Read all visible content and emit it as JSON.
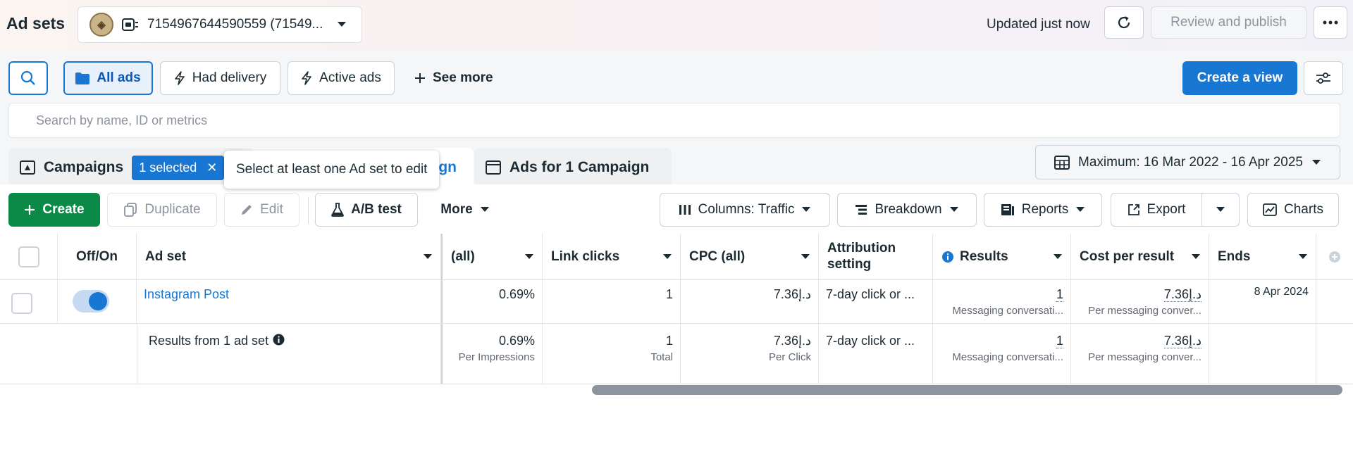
{
  "header": {
    "title": "Ad sets",
    "account_id": "7154967644590559 (71549...",
    "updated": "Updated just now",
    "review_publish": "Review and publish"
  },
  "filters": {
    "all_ads": "All ads",
    "had_delivery": "Had delivery",
    "active_ads": "Active ads",
    "see_more": "See more",
    "create_view": "Create a view"
  },
  "search": {
    "placeholder": "Search by name, ID or metrics"
  },
  "tabs": {
    "campaigns": "Campaigns",
    "selected": "1 selected",
    "adsets_visible": "ign",
    "ads": "Ads for 1 Campaign"
  },
  "tooltip": "Select at least one Ad set to edit",
  "date_range": "Maximum: 16 Mar 2022 - 16 Apr 2025",
  "toolbar": {
    "create": "Create",
    "duplicate": "Duplicate",
    "edit": "Edit",
    "ab_test": "A/B test",
    "more": "More",
    "columns": "Columns: Traffic",
    "breakdown": "Breakdown",
    "reports": "Reports",
    "export": "Export",
    "charts": "Charts"
  },
  "table": {
    "headers": {
      "off_on": "Off/On",
      "ad_set": "Ad set",
      "ctr": "(all)",
      "link_clicks": "Link clicks",
      "cpc": "CPC (all)",
      "attribution": "Attribution setting",
      "results": "Results",
      "cost_per_result": "Cost per result",
      "ends": "Ends"
    },
    "row": {
      "name": "Instagram Post",
      "ctr": "0.69%",
      "link_clicks": "1",
      "cpc": "7.36د.إ",
      "attribution": "7-day click or ...",
      "results": "1",
      "results_sub": "Messaging conversati...",
      "cost": "7.36د.إ",
      "cost_sub": "Per messaging conver...",
      "ends": "8 Apr 2024"
    },
    "summary": {
      "label": "Results from 1 ad set",
      "ctr": "0.69%",
      "ctr_sub": "Per Impressions",
      "link_clicks": "1",
      "link_clicks_sub": "Total",
      "cpc": "7.36د.إ",
      "cpc_sub": "Per Click",
      "attribution": "7-day click or ...",
      "results": "1",
      "results_sub": "Messaging conversati...",
      "cost": "7.36د.إ",
      "cost_sub": "Per messaging conver..."
    }
  },
  "colors": {
    "accent": "#1877d2",
    "create_green": "#0b8a47"
  }
}
